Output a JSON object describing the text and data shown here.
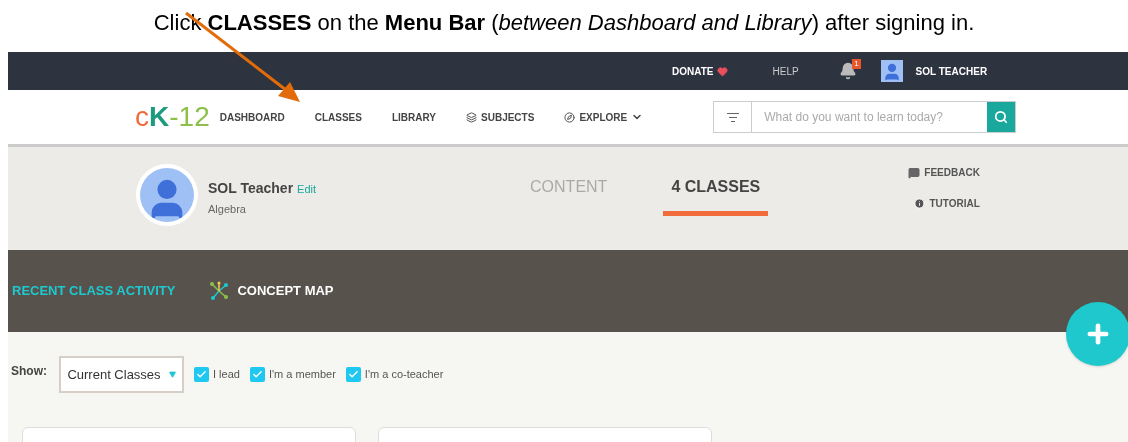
{
  "caption": "Click **CLASSES** on the **Menu Bar** (*between Dashboard and Library*) after signing in.",
  "topbar": {
    "donate": "DONATE",
    "help": "HELP",
    "notifications": "1",
    "user": "SOL TEACHER"
  },
  "nav": {
    "logo": {
      "c": "c",
      "k": "K",
      "rest": "-12"
    },
    "items": [
      {
        "label": "DASHBOARD",
        "kind": "link"
      },
      {
        "label": "CLASSES",
        "kind": "link"
      },
      {
        "label": "LIBRARY",
        "kind": "link"
      },
      {
        "label": "SUBJECTS",
        "kind": "subjects"
      },
      {
        "label": "EXPLORE",
        "kind": "explore"
      }
    ],
    "search": {
      "placeholder": "What do you want to learn today?"
    }
  },
  "profile": {
    "name": "SOL Teacher",
    "edit": "Edit",
    "subject": "Algebra",
    "tabs": [
      {
        "label": "CONTENT",
        "selected": false
      },
      {
        "label": "4 CLASSES",
        "selected": true
      }
    ],
    "links": [
      {
        "label": "FEEDBACK",
        "kind": "feedback"
      },
      {
        "label": "TUTORIAL",
        "kind": "tutorial"
      }
    ]
  },
  "subnav": [
    {
      "label": "RECENT CLASS ACTIVITY",
      "selected": true,
      "kind": "text"
    },
    {
      "label": "CONCEPT MAP",
      "selected": false,
      "kind": "map"
    }
  ],
  "filters": {
    "label": "Show:",
    "dropdown": "Current Classes",
    "checks": [
      {
        "label": "I lead",
        "checked": true
      },
      {
        "label": "I'm a member",
        "checked": true
      },
      {
        "label": "I'm a co-teacher",
        "checked": true
      }
    ]
  },
  "cards": [
    {
      "kind": "card"
    },
    {
      "kind": "card"
    }
  ]
}
